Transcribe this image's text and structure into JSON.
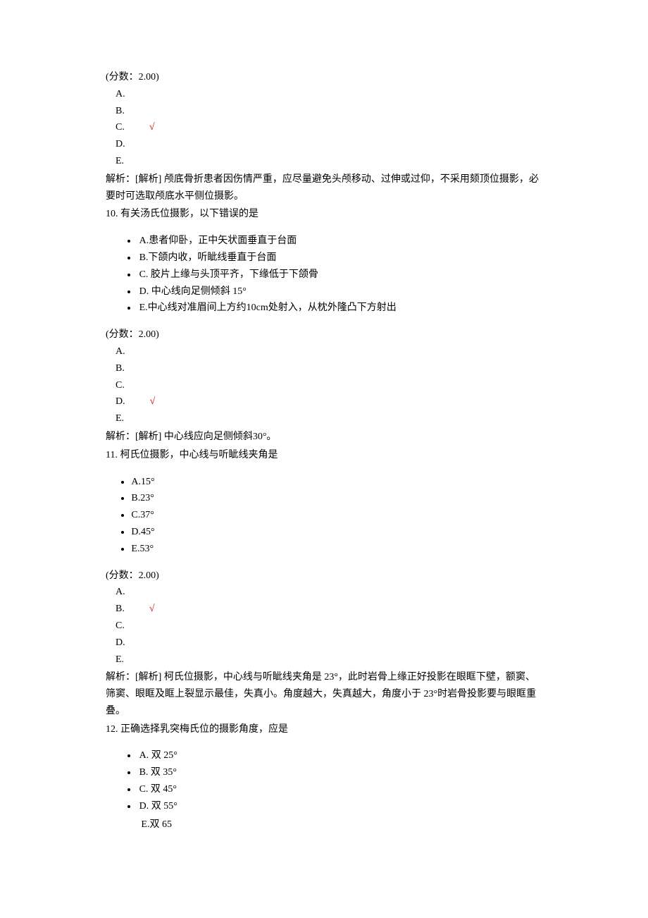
{
  "q9_tail": {
    "score": "(分数：2.00)",
    "answers": {
      "A": "A.",
      "B": "B.",
      "C": "C.",
      "D": "D.",
      "E": "E."
    },
    "correct": "√",
    "analysis": "解析：[解析]  颅底骨折患者因伤情严重，应尽量避免头颅移动、过伸或过仰，不采用颏顶位摄影，必要时可选取颅底水平侧位摄影。"
  },
  "q10": {
    "stem": "10. 有关汤氏位摄影，以下错误的是",
    "opts": {
      "A": "A.患者仰卧，正中矢状面垂直于台面",
      "B": "B.下颌内收，听眦线垂直于台面",
      "C": "C. 胶片上缘与头顶平齐，下缘低于下颌骨",
      "D": "D. 中心线向足侧倾斜 15°",
      "E": "E.中心线对准眉间上方约10cm处射入，从枕外隆凸下方射出"
    },
    "score": "(分数：2.00)",
    "answers": {
      "A": "A.",
      "B": "B.",
      "C": "C.",
      "D": "D.",
      "E": "E."
    },
    "correct": "√",
    "analysis": "解析：[解析]  中心线应向足侧倾斜30°。"
  },
  "q11": {
    "stem": "11. 柯氏位摄影，中心线与听眦线夹角是",
    "opts": {
      "A": "A.15°",
      "B": "B.23°",
      "C": "C.37°",
      "D": "D.45°",
      "E": "E.53°"
    },
    "score": "(分数：2.00)",
    "answers": {
      "A": "A.",
      "B": "B.",
      "C": "C.",
      "D": "D.",
      "E": "E."
    },
    "correct": "√",
    "analysis": "解析：[解析]  柯氏位摄影，中心线与听眦线夹角是 23°，此时岩骨上缘正好投影在眼眶下壁，额窦、筛窦、眼眶及眶上裂显示最佳，失真小。角度越大，失真越大，角度小于 23°时岩骨投影要与眼眶重叠。"
  },
  "q12": {
    "stem": "12. 正确选择乳突梅氏位的摄影角度，应是",
    "opts": {
      "A": "A. 双 25°",
      "B": "B. 双 35°",
      "C": "C. 双 45°",
      "D": "D. 双 55°",
      "E": "E.双 65"
    }
  }
}
